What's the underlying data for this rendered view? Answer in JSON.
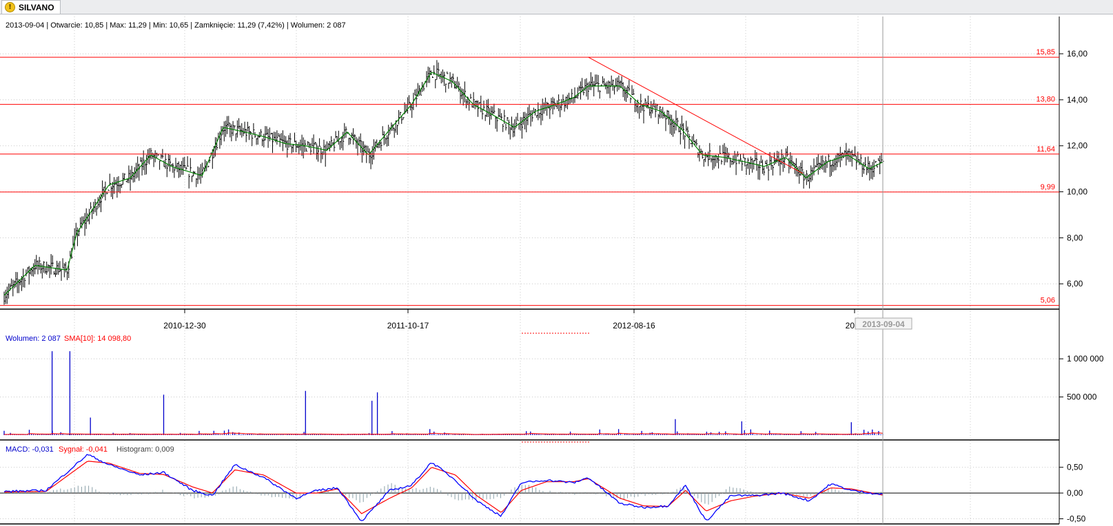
{
  "tab": {
    "title": "SILVANO",
    "icon": "warning-icon"
  },
  "colors": {
    "price": "#000000",
    "sma": "#008000",
    "level": "#ff0000",
    "volume": "#0000cc",
    "vol_sma": "#ff0000",
    "macd": "#0000ff",
    "signal": "#ff0000",
    "hist": "#8aa0a8",
    "grid": "#c8c8c8"
  },
  "chart_data": [
    {
      "type": "line",
      "panel": "price",
      "info": "2013-09-04 | Otwarcie: 10,85 | Max: 11,29 | Min: 10,65 | Zamknięcie: 11,29 (7,42%) | Wolumen: 2 087",
      "x_ticks": [
        "2010-12-30",
        "2011-10-17",
        "2012-08-16",
        "2013"
      ],
      "cursor_date": "2013-09-04",
      "y_ticks": [
        "6,00",
        "8,00",
        "10,00",
        "12,00",
        "14,00",
        "16,00"
      ],
      "ylim": [
        4.9,
        16.9
      ],
      "x": [
        "2010-03-01",
        "2010-04-15",
        "2010-06-01",
        "2010-06-15",
        "2010-08-01",
        "2010-09-01",
        "2010-10-01",
        "2010-11-01",
        "2010-12-15",
        "2011-01-15",
        "2011-02-15",
        "2011-03-15",
        "2011-04-15",
        "2011-05-15",
        "2011-06-15",
        "2011-07-15",
        "2011-08-15",
        "2011-09-15",
        "2011-10-17",
        "2011-11-15",
        "2011-12-15",
        "2012-01-15",
        "2012-02-15",
        "2012-03-15",
        "2012-04-15",
        "2012-05-15",
        "2012-06-10",
        "2012-07-01",
        "2012-08-16",
        "2012-09-15",
        "2012-10-15",
        "2012-11-15",
        "2012-12-15",
        "2013-01-15",
        "2013-02-15",
        "2013-03-15",
        "2013-04-15",
        "2013-05-15",
        "2013-06-15",
        "2013-07-15",
        "2013-08-15",
        "2013-09-04"
      ],
      "values": [
        5.5,
        6.8,
        6.6,
        8.2,
        10.3,
        10.6,
        11.6,
        11.1,
        10.7,
        12.8,
        12.6,
        12.4,
        12.1,
        12.0,
        11.8,
        12.6,
        11.6,
        12.7,
        13.8,
        15.2,
        14.8,
        13.8,
        13.3,
        12.8,
        13.5,
        13.8,
        14.1,
        14.6,
        14.6,
        13.8,
        13.5,
        12.7,
        11.6,
        11.5,
        11.3,
        11.1,
        11.5,
        10.6,
        11.3,
        11.6,
        11.0,
        11.29
      ],
      "levels": [
        15.85,
        13.8,
        11.64,
        9.99,
        5.06
      ],
      "level_labels": [
        "15,85",
        "13,80",
        "11,64",
        "9,99",
        "5,06"
      ],
      "trendline": {
        "from": [
          "2012-07-01",
          15.85
        ],
        "to": [
          "2013-05-10",
          10.8
        ]
      }
    },
    {
      "type": "bar",
      "panel": "volume",
      "info": "Wolumen: 2 087",
      "sma_label": "SMA[10]: 14 098,80",
      "y_ticks": [
        "500 000",
        "1 000 000"
      ],
      "ylim": [
        0,
        1200000
      ],
      "spikes": [
        [
          "2010-05-10",
          1100000
        ],
        [
          "2010-06-05",
          1100000
        ],
        [
          "2010-07-05",
          230000
        ],
        [
          "2010-10-20",
          530000
        ],
        [
          "2011-05-15",
          580000
        ],
        [
          "2011-08-20",
          450000
        ],
        [
          "2011-08-28",
          560000
        ],
        [
          "2012-11-05",
          210000
        ],
        [
          "2013-02-10",
          180000
        ],
        [
          "2013-07-20",
          170000
        ]
      ]
    },
    {
      "type": "line",
      "panel": "macd",
      "macd_label": "MACD: -0,031",
      "signal_label": "Sygnał: -0,041",
      "hist_label": "Histogram: 0,009",
      "y_ticks": [
        "-0,50",
        "0,00",
        "0,50"
      ],
      "ylim": [
        -0.6,
        0.75
      ],
      "x": [
        "2010-03-01",
        "2010-05-01",
        "2010-07-01",
        "2010-08-01",
        "2010-09-15",
        "2010-10-20",
        "2010-12-01",
        "2010-12-30",
        "2011-02-01",
        "2011-03-15",
        "2011-05-01",
        "2011-06-01",
        "2011-07-01",
        "2011-08-05",
        "2011-09-15",
        "2011-10-17",
        "2011-11-15",
        "2011-12-20",
        "2012-01-20",
        "2012-02-25",
        "2012-03-25",
        "2012-05-01",
        "2012-06-10",
        "2012-07-01",
        "2012-08-16",
        "2012-09-20",
        "2012-10-25",
        "2012-11-20",
        "2012-12-20",
        "2013-01-25",
        "2013-03-01",
        "2013-04-10",
        "2013-05-20",
        "2013-06-20",
        "2013-07-20",
        "2013-09-04"
      ],
      "values": [
        0.03,
        0.05,
        0.75,
        0.55,
        0.35,
        0.4,
        0.05,
        -0.05,
        0.55,
        0.3,
        -0.1,
        0.05,
        0.1,
        -0.55,
        0.05,
        0.15,
        0.6,
        0.25,
        -0.15,
        -0.45,
        0.2,
        0.25,
        0.2,
        0.3,
        -0.2,
        -0.28,
        -0.25,
        0.15,
        -0.55,
        -0.05,
        -0.05,
        0.0,
        -0.15,
        0.18,
        0.05,
        -0.03
      ],
      "signal": [
        0.02,
        0.03,
        0.62,
        0.58,
        0.38,
        0.36,
        0.12,
        0.0,
        0.45,
        0.35,
        0.0,
        0.0,
        0.08,
        -0.4,
        -0.1,
        0.1,
        0.5,
        0.35,
        -0.05,
        -0.38,
        0.05,
        0.22,
        0.22,
        0.28,
        -0.1,
        -0.25,
        -0.26,
        0.05,
        -0.35,
        -0.15,
        -0.06,
        0.0,
        -0.1,
        0.1,
        0.08,
        -0.04
      ]
    }
  ]
}
